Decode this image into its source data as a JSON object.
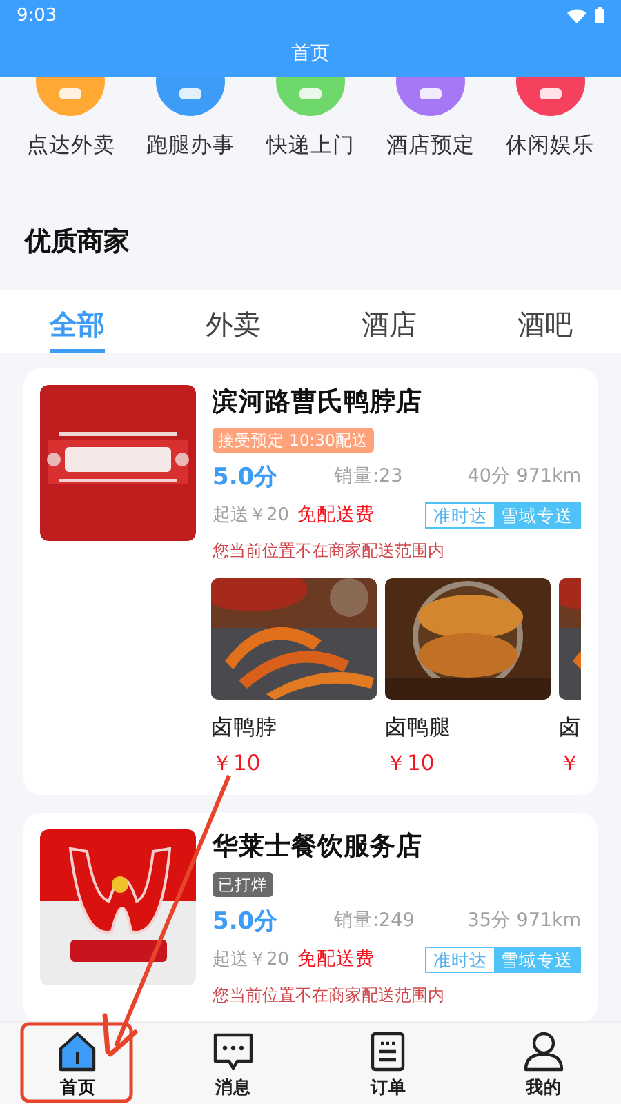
{
  "status_bar": {
    "time": "9:03"
  },
  "header": {
    "title": "首页"
  },
  "categories": [
    {
      "label": "点达外卖",
      "color": "#ffa833"
    },
    {
      "label": "跑腿办事",
      "color": "#3d9cf5"
    },
    {
      "label": "快递上门",
      "color": "#6fd86a"
    },
    {
      "label": "酒店预定",
      "color": "#a678f5"
    },
    {
      "label": "休闲娱乐",
      "color": "#f5405e"
    }
  ],
  "section_title": "优质商家",
  "tabs": [
    {
      "label": "全部",
      "selected": true
    },
    {
      "label": "外卖",
      "selected": false
    },
    {
      "label": "酒店",
      "selected": false
    },
    {
      "label": "酒吧",
      "selected": false
    }
  ],
  "shops": [
    {
      "name": "滨河路曹氏鸭脖店",
      "badge": {
        "text": "接受预定 10:30配送",
        "kind": "reserve"
      },
      "rating": "5.0分",
      "sales": "销量:23",
      "eta": "40分 971km",
      "min_order": "起送￥20",
      "delivery_fee": "免配送费",
      "tags": [
        "准时达",
        "雪域专送"
      ],
      "notice": "您当前位置不在商家配送范围内",
      "products": [
        {
          "name": "卤鸭脖",
          "price": "￥10"
        },
        {
          "name": "卤鸭腿",
          "price": "￥10"
        },
        {
          "name": "卤",
          "price": "￥"
        }
      ]
    },
    {
      "name": "华莱士餐饮服务店",
      "badge": {
        "text": "已打烊",
        "kind": "closed"
      },
      "rating": "5.0分",
      "sales": "销量:249",
      "eta": "35分 971km",
      "min_order": "起送￥20",
      "delivery_fee": "免配送费",
      "tags": [
        "准时达",
        "雪域专送"
      ],
      "notice": "您当前位置不在商家配送范围内"
    }
  ],
  "bottom_nav": [
    {
      "label": "首页",
      "selected": true
    },
    {
      "label": "消息",
      "selected": false
    },
    {
      "label": "订单",
      "selected": false
    },
    {
      "label": "我的",
      "selected": false
    }
  ]
}
